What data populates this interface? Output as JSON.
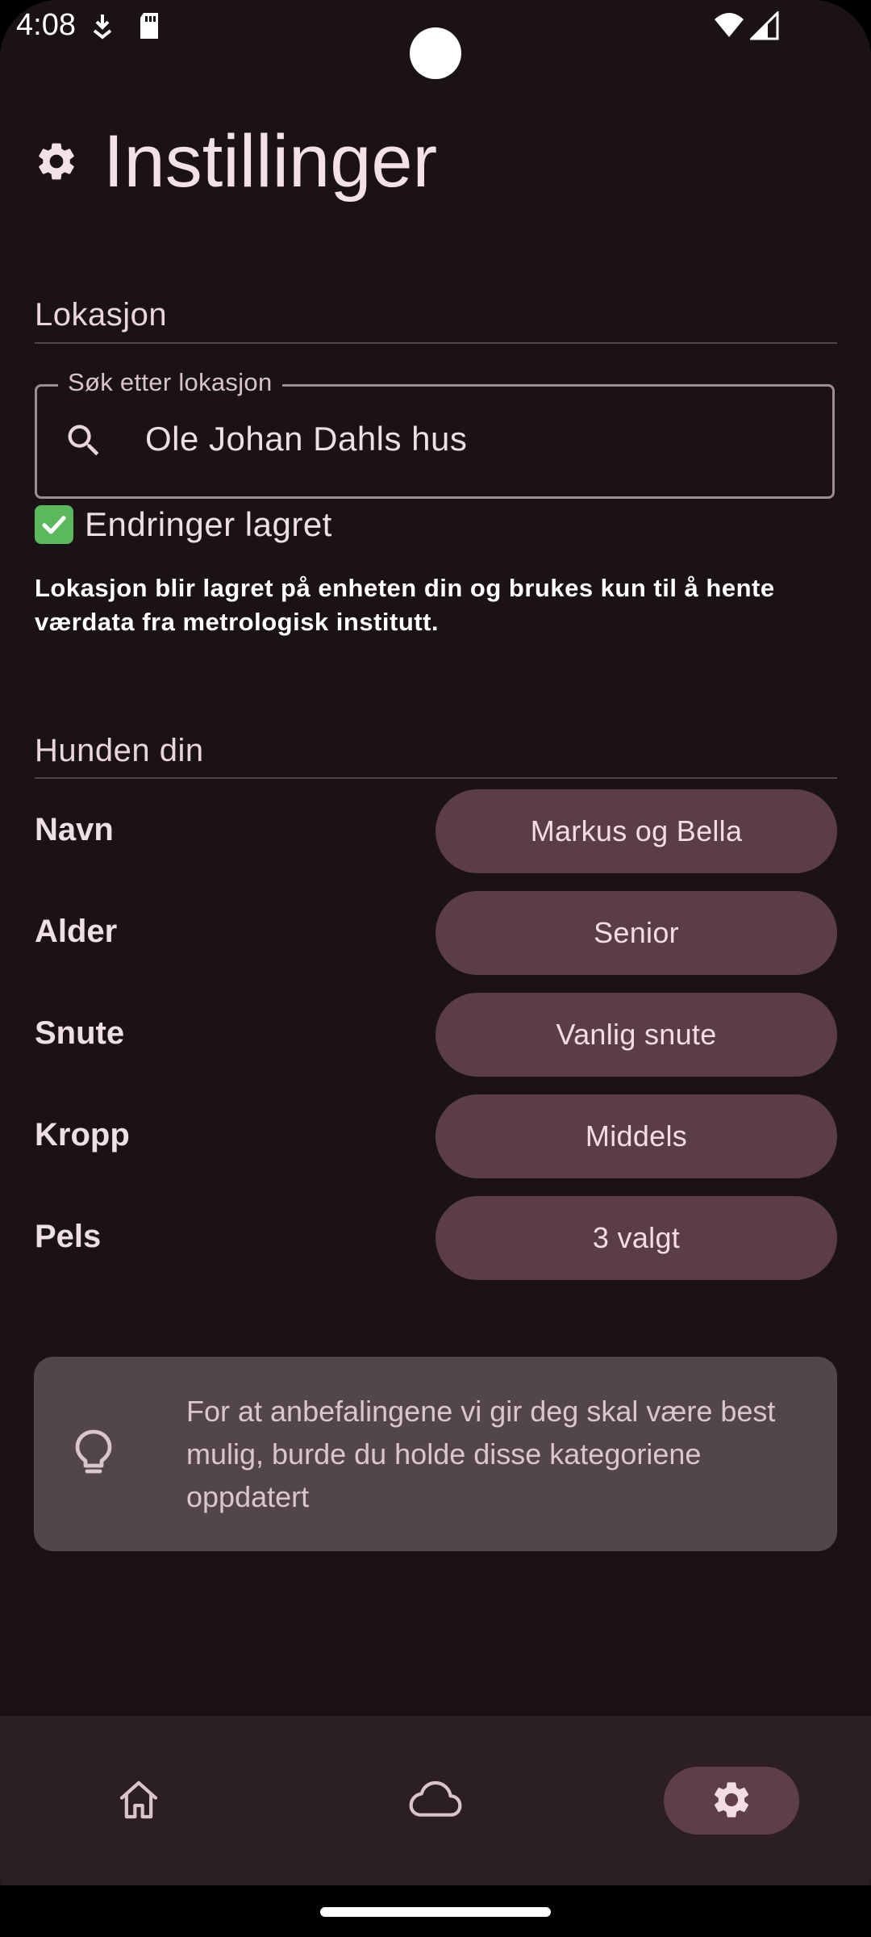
{
  "status_bar": {
    "time": "4:08"
  },
  "header": {
    "title": "Instillinger",
    "icon": "gear-icon"
  },
  "location": {
    "section_title": "Lokasjon",
    "search_label": "Søk etter lokasjon",
    "search_value": "Ole Johan Dahls hus",
    "saved_status": "Endringer lagret",
    "info": "Lokasjon blir lagret på enheten din og brukes kun til å hente værdata fra metrologisk institutt."
  },
  "dog": {
    "section_title": "Hunden din",
    "rows": [
      {
        "label": "Navn",
        "value": "Markus og Bella"
      },
      {
        "label": "Alder",
        "value": "Senior"
      },
      {
        "label": "Snute",
        "value": "Vanlig snute"
      },
      {
        "label": "Kropp",
        "value": "Middels"
      },
      {
        "label": "Pels",
        "value": "3 valgt"
      }
    ]
  },
  "tip": {
    "text": "For at anbefalingene vi gir deg skal være best mulig, burde du holde disse kategoriene oppdatert",
    "icon": "lightbulb-icon"
  },
  "bottom_nav": {
    "items": [
      {
        "icon": "home-icon",
        "active": false
      },
      {
        "icon": "cloud-icon",
        "active": false
      },
      {
        "icon": "gear-icon",
        "active": true
      }
    ]
  },
  "colors": {
    "background": "#1b1215",
    "pill": "#5a3d45",
    "card": "#524649",
    "nav_background": "#2b1f23",
    "nav_active": "#5e3f48",
    "check_green": "#5cb85c"
  }
}
